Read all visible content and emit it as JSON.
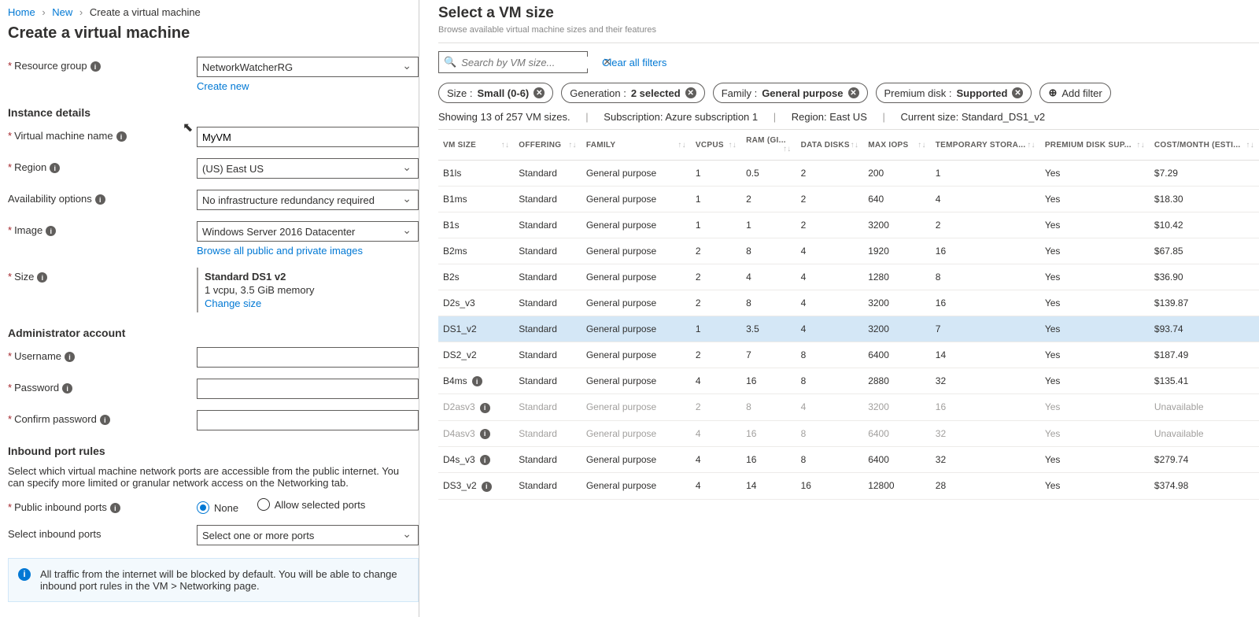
{
  "breadcrumb": {
    "home": "Home",
    "new": "New",
    "current": "Create a virtual machine"
  },
  "pageTitle": "Create a virtual machine",
  "form": {
    "resourceGroup": {
      "label": "Resource group",
      "value": "NetworkWatcherRG",
      "createNew": "Create new"
    },
    "instanceDetails": "Instance details",
    "vmName": {
      "label": "Virtual machine name",
      "value": "MyVM"
    },
    "region": {
      "label": "Region",
      "value": "(US) East US"
    },
    "avail": {
      "label": "Availability options",
      "value": "No infrastructure redundancy required"
    },
    "image": {
      "label": "Image",
      "value": "Windows Server 2016 Datacenter",
      "browse": "Browse all public and private images"
    },
    "size": {
      "label": "Size",
      "name": "Standard DS1 v2",
      "desc": "1 vcpu, 3.5 GiB memory",
      "change": "Change size"
    },
    "admin": "Administrator account",
    "username": {
      "label": "Username"
    },
    "password": {
      "label": "Password"
    },
    "confirm": {
      "label": "Confirm password"
    },
    "portsSection": "Inbound port rules",
    "portsHelp": "Select which virtual machine network ports are accessible from the public internet. You can specify more limited or granular network access on the Networking tab.",
    "publicPorts": {
      "label": "Public inbound ports",
      "none": "None",
      "allow": "Allow selected ports"
    },
    "selectPorts": {
      "label": "Select inbound ports",
      "value": "Select one or more ports"
    },
    "infobox": "All traffic from the internet will be blocked by default. You will be able to change inbound port rules in the VM > Networking page."
  },
  "panel": {
    "title": "Select a VM size",
    "subtitle": "Browse available virtual machine sizes and their features",
    "searchPlaceholder": "Search by VM size...",
    "clearFilters": "Clear all filters",
    "filters": [
      {
        "label": "Size : ",
        "value": "Small (0-6)"
      },
      {
        "label": "Generation : ",
        "value": "2 selected"
      },
      {
        "label": "Family : ",
        "value": "General purpose"
      },
      {
        "label": "Premium disk : ",
        "value": "Supported"
      }
    ],
    "addFilter": "Add filter",
    "status": {
      "showing": "Showing 13 of 257 VM sizes.",
      "subLabel": "Subscription: ",
      "subVal": "Azure subscription 1",
      "regLabel": "Region: ",
      "regVal": "East US",
      "curLabel": "Current size: ",
      "curVal": "Standard_DS1_v2"
    },
    "columns": [
      "VM SIZE",
      "OFFERING",
      "FAMILY",
      "VCPUS",
      "RAM (GI...",
      "DATA DISKS",
      "MAX IOPS",
      "TEMPORARY STORA...",
      "PREMIUM DISK SUP...",
      "COST/MONTH (ESTI..."
    ],
    "rows": [
      {
        "c": [
          "B1ls",
          "Standard",
          "General purpose",
          "1",
          "0.5",
          "2",
          "200",
          "1",
          "Yes",
          "$7.29"
        ]
      },
      {
        "c": [
          "B1ms",
          "Standard",
          "General purpose",
          "1",
          "2",
          "2",
          "640",
          "4",
          "Yes",
          "$18.30"
        ]
      },
      {
        "c": [
          "B1s",
          "Standard",
          "General purpose",
          "1",
          "1",
          "2",
          "3200",
          "2",
          "Yes",
          "$10.42"
        ]
      },
      {
        "c": [
          "B2ms",
          "Standard",
          "General purpose",
          "2",
          "8",
          "4",
          "1920",
          "16",
          "Yes",
          "$67.85"
        ]
      },
      {
        "c": [
          "B2s",
          "Standard",
          "General purpose",
          "2",
          "4",
          "4",
          "1280",
          "8",
          "Yes",
          "$36.90"
        ]
      },
      {
        "c": [
          "D2s_v3",
          "Standard",
          "General purpose",
          "2",
          "8",
          "4",
          "3200",
          "16",
          "Yes",
          "$139.87"
        ]
      },
      {
        "c": [
          "DS1_v2",
          "Standard",
          "General purpose",
          "1",
          "3.5",
          "4",
          "3200",
          "7",
          "Yes",
          "$93.74"
        ],
        "sel": true
      },
      {
        "c": [
          "DS2_v2",
          "Standard",
          "General purpose",
          "2",
          "7",
          "8",
          "6400",
          "14",
          "Yes",
          "$187.49"
        ]
      },
      {
        "c": [
          "B4ms",
          "Standard",
          "General purpose",
          "4",
          "16",
          "8",
          "2880",
          "32",
          "Yes",
          "$135.41"
        ],
        "info": true
      },
      {
        "c": [
          "D2asv3",
          "Standard",
          "General purpose",
          "2",
          "8",
          "4",
          "3200",
          "16",
          "Yes",
          "Unavailable"
        ],
        "dis": true,
        "info": true
      },
      {
        "c": [
          "D4asv3",
          "Standard",
          "General purpose",
          "4",
          "16",
          "8",
          "6400",
          "32",
          "Yes",
          "Unavailable"
        ],
        "dis": true,
        "info": true
      },
      {
        "c": [
          "D4s_v3",
          "Standard",
          "General purpose",
          "4",
          "16",
          "8",
          "6400",
          "32",
          "Yes",
          "$279.74"
        ],
        "info": true
      },
      {
        "c": [
          "DS3_v2",
          "Standard",
          "General purpose",
          "4",
          "14",
          "16",
          "12800",
          "28",
          "Yes",
          "$374.98"
        ],
        "info": true
      }
    ]
  }
}
